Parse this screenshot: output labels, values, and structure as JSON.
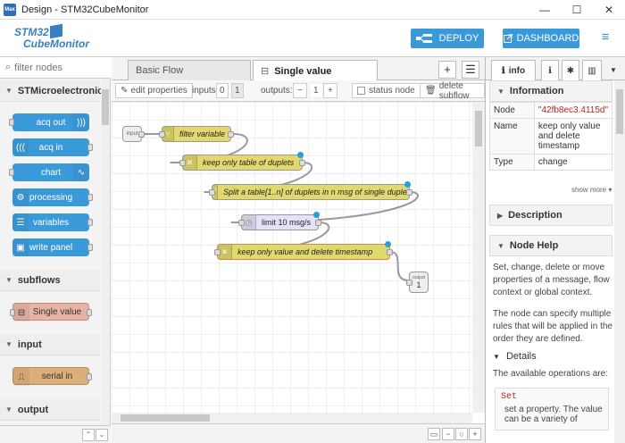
{
  "window": {
    "title": "Design - STM32CubeMonitor",
    "icon_text": "Max",
    "minimize": "—",
    "maximize": "☐",
    "close": "✕"
  },
  "header": {
    "logo_line1": "STM32",
    "logo_line2": "CubeMonitor",
    "deploy_label": "DEPLOY",
    "dashboard_label": "DASHBOARD",
    "menu_icon": "≡"
  },
  "palette": {
    "search_placeholder": "filter nodes",
    "categories": [
      {
        "label": "STMicroelectronics"
      },
      {
        "label": "subflows"
      },
      {
        "label": "input"
      },
      {
        "label": "output"
      }
    ],
    "nodes": [
      {
        "label": "acq out"
      },
      {
        "label": "acq in"
      },
      {
        "label": "chart"
      },
      {
        "label": "processing"
      },
      {
        "label": "variables"
      },
      {
        "label": "write panel"
      },
      {
        "label": "Single value"
      },
      {
        "label": "serial in"
      }
    ]
  },
  "workspace": {
    "tabs": [
      {
        "label": "Basic Flow"
      },
      {
        "label": "Single value"
      }
    ],
    "toolbar": {
      "edit_properties": "edit properties",
      "inputs_label": "inputs:",
      "inputs_0": "0",
      "inputs_1": "1",
      "outputs_label": "outputs:",
      "outputs_minus": "−",
      "outputs_value": "1",
      "outputs_plus": "+",
      "status_node": "status node",
      "delete_subflow": "delete subflow"
    },
    "flow_nodes": [
      {
        "label": "input"
      },
      {
        "label": "filter variable"
      },
      {
        "label": "keep only table of duplets"
      },
      {
        "label": "Split a table[1..n] of duplets in n msg of single duplet"
      },
      {
        "label": "limit 10 msg/s"
      },
      {
        "label": "keep only value and delete timestamp"
      },
      {
        "label": "output"
      },
      {
        "label": "1"
      }
    ]
  },
  "sidebar": {
    "tab_info": "info",
    "info_section": "Information",
    "table": [
      {
        "key": "Node",
        "value": "\"42fb8ec3.4115d\""
      },
      {
        "key": "Name",
        "value": "keep only value and delete timestamp"
      },
      {
        "key": "Type",
        "value": "change"
      }
    ],
    "show_more": "show more ▾",
    "description_section": "Description",
    "node_help_section": "Node Help",
    "help_p1": "Set, change, delete or move properties of a message, flow context or global context.",
    "help_p2": "The node can specify multiple rules that will be applied in the order they are defined.",
    "details_label": "Details",
    "help_p3": "The available operations are:",
    "code_set": "Set",
    "code_desc": "set a property. The value can be a variety of"
  }
}
